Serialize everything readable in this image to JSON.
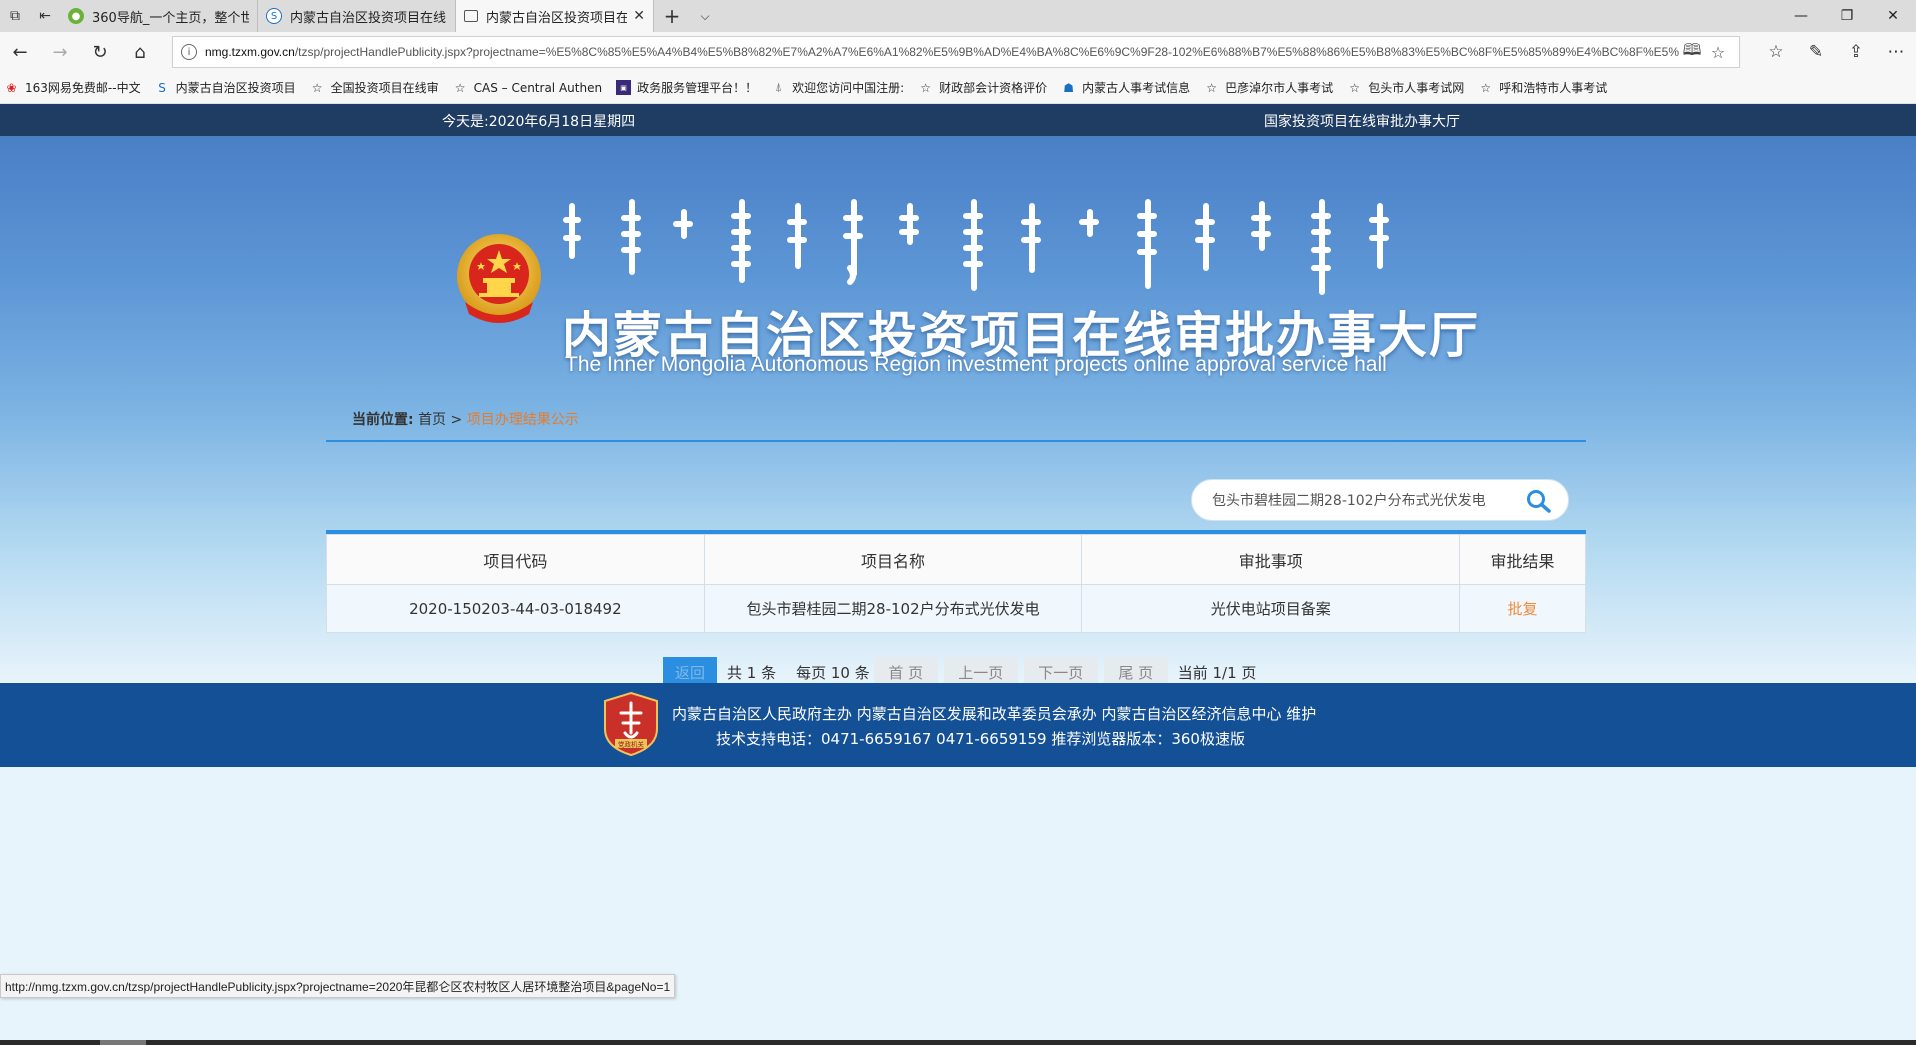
{
  "browser": {
    "tabs": [
      {
        "label": "360导航_一个主页，整个世",
        "active": false
      },
      {
        "label": "内蒙古自治区投资项目在线",
        "active": false
      },
      {
        "label": "内蒙古自治区投资项目在",
        "active": true
      }
    ],
    "url_host": "nmg.tzxm.gov.cn",
    "url_path": "/tzsp/projectHandlePublicity.jspx?projectname=%E5%8C%85%E5%A4%B4%E5%B8%82%E7%A2%A7%E6%A1%82%E5%9B%AD%E4%BA%8C%E6%9C%9F28-102%E6%88%B7%E5%88%86%E5%B8%83%E5%BC%8F%E5%85%89%E4%BC%8F%E5%",
    "favorites": [
      "163网易免费邮--中文",
      "内蒙古自治区投资项目",
      "全国投资项目在线审",
      "CAS – Central Authen",
      "政务服务管理平台！！",
      "欢迎您访问中国注册:",
      "财政部会计资格评价",
      "内蒙古人事考试信息",
      "巴彦淖尔市人事考试",
      "包头市人事考试网",
      "呼和浩特市人事考试"
    ],
    "status_url": "http://nmg.tzxm.gov.cn/tzsp/projectHandlePublicity.jspx?projectname=2020年昆都仑区农村牧区人居环境整治项目&pageNo=1"
  },
  "site": {
    "today": "今天是:2020年6月18日星期四",
    "national_link": "国家投资项目在线审批办事大厅",
    "title_cn": "内蒙古自治区投资项目在线审批办事大厅",
    "title_en": "The Inner Mongolia Autonomous Region investment projects online approval service hall"
  },
  "breadcrumb": {
    "label": "当前位置:",
    "home": "首页",
    "sep": ">",
    "current": "项目办理结果公示"
  },
  "search": {
    "value": "包头市碧桂园二期28-102户分布式光伏发电"
  },
  "table": {
    "headers": [
      "项目代码",
      "项目名称",
      "审批事项",
      "审批结果"
    ],
    "rows": [
      {
        "code": "2020-150203-44-03-018492",
        "name": "包头市碧桂园二期28-102户分布式光伏发电",
        "item": "光伏电站项目备案",
        "result": "批复"
      }
    ]
  },
  "pager": {
    "back": "返回",
    "total": "共 1 条",
    "per_page": "每页 10 条",
    "first": "首 页",
    "prev": "上一页",
    "next": "下一页",
    "last": "尾 页",
    "current": "当前 1/1 页"
  },
  "footer": {
    "line1": "内蒙古自治区人民政府主办 内蒙古自治区发展和改革委员会承办 内蒙古自治区经济信息中心 维护",
    "line2": "技术支持电话：0471-6659167 0471-6659159 推荐浏览器版本：360极速版",
    "badge_text": "党政机关"
  },
  "colors": {
    "accent": "#2b8ee0",
    "header_dark": "#1f3c62",
    "footer": "#145095",
    "link_orange": "#f08a3c"
  }
}
